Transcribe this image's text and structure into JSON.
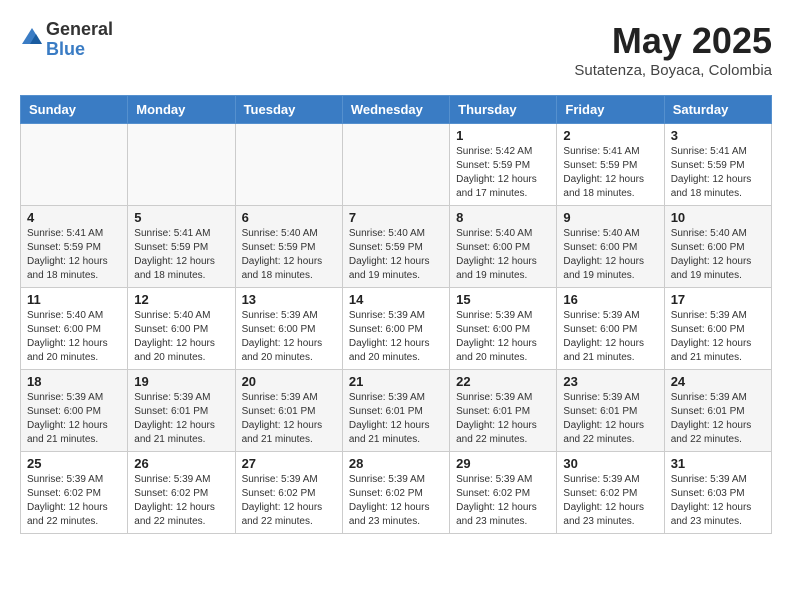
{
  "logo": {
    "general": "General",
    "blue": "Blue"
  },
  "title": {
    "month": "May 2025",
    "location": "Sutatenza, Boyaca, Colombia"
  },
  "weekdays": [
    "Sunday",
    "Monday",
    "Tuesday",
    "Wednesday",
    "Thursday",
    "Friday",
    "Saturday"
  ],
  "weeks": [
    [
      {
        "day": "",
        "info": ""
      },
      {
        "day": "",
        "info": ""
      },
      {
        "day": "",
        "info": ""
      },
      {
        "day": "",
        "info": ""
      },
      {
        "day": "1",
        "info": "Sunrise: 5:42 AM\nSunset: 5:59 PM\nDaylight: 12 hours\nand 17 minutes."
      },
      {
        "day": "2",
        "info": "Sunrise: 5:41 AM\nSunset: 5:59 PM\nDaylight: 12 hours\nand 18 minutes."
      },
      {
        "day": "3",
        "info": "Sunrise: 5:41 AM\nSunset: 5:59 PM\nDaylight: 12 hours\nand 18 minutes."
      }
    ],
    [
      {
        "day": "4",
        "info": "Sunrise: 5:41 AM\nSunset: 5:59 PM\nDaylight: 12 hours\nand 18 minutes."
      },
      {
        "day": "5",
        "info": "Sunrise: 5:41 AM\nSunset: 5:59 PM\nDaylight: 12 hours\nand 18 minutes."
      },
      {
        "day": "6",
        "info": "Sunrise: 5:40 AM\nSunset: 5:59 PM\nDaylight: 12 hours\nand 18 minutes."
      },
      {
        "day": "7",
        "info": "Sunrise: 5:40 AM\nSunset: 5:59 PM\nDaylight: 12 hours\nand 19 minutes."
      },
      {
        "day": "8",
        "info": "Sunrise: 5:40 AM\nSunset: 6:00 PM\nDaylight: 12 hours\nand 19 minutes."
      },
      {
        "day": "9",
        "info": "Sunrise: 5:40 AM\nSunset: 6:00 PM\nDaylight: 12 hours\nand 19 minutes."
      },
      {
        "day": "10",
        "info": "Sunrise: 5:40 AM\nSunset: 6:00 PM\nDaylight: 12 hours\nand 19 minutes."
      }
    ],
    [
      {
        "day": "11",
        "info": "Sunrise: 5:40 AM\nSunset: 6:00 PM\nDaylight: 12 hours\nand 20 minutes."
      },
      {
        "day": "12",
        "info": "Sunrise: 5:40 AM\nSunset: 6:00 PM\nDaylight: 12 hours\nand 20 minutes."
      },
      {
        "day": "13",
        "info": "Sunrise: 5:39 AM\nSunset: 6:00 PM\nDaylight: 12 hours\nand 20 minutes."
      },
      {
        "day": "14",
        "info": "Sunrise: 5:39 AM\nSunset: 6:00 PM\nDaylight: 12 hours\nand 20 minutes."
      },
      {
        "day": "15",
        "info": "Sunrise: 5:39 AM\nSunset: 6:00 PM\nDaylight: 12 hours\nand 20 minutes."
      },
      {
        "day": "16",
        "info": "Sunrise: 5:39 AM\nSunset: 6:00 PM\nDaylight: 12 hours\nand 21 minutes."
      },
      {
        "day": "17",
        "info": "Sunrise: 5:39 AM\nSunset: 6:00 PM\nDaylight: 12 hours\nand 21 minutes."
      }
    ],
    [
      {
        "day": "18",
        "info": "Sunrise: 5:39 AM\nSunset: 6:00 PM\nDaylight: 12 hours\nand 21 minutes."
      },
      {
        "day": "19",
        "info": "Sunrise: 5:39 AM\nSunset: 6:01 PM\nDaylight: 12 hours\nand 21 minutes."
      },
      {
        "day": "20",
        "info": "Sunrise: 5:39 AM\nSunset: 6:01 PM\nDaylight: 12 hours\nand 21 minutes."
      },
      {
        "day": "21",
        "info": "Sunrise: 5:39 AM\nSunset: 6:01 PM\nDaylight: 12 hours\nand 21 minutes."
      },
      {
        "day": "22",
        "info": "Sunrise: 5:39 AM\nSunset: 6:01 PM\nDaylight: 12 hours\nand 22 minutes."
      },
      {
        "day": "23",
        "info": "Sunrise: 5:39 AM\nSunset: 6:01 PM\nDaylight: 12 hours\nand 22 minutes."
      },
      {
        "day": "24",
        "info": "Sunrise: 5:39 AM\nSunset: 6:01 PM\nDaylight: 12 hours\nand 22 minutes."
      }
    ],
    [
      {
        "day": "25",
        "info": "Sunrise: 5:39 AM\nSunset: 6:02 PM\nDaylight: 12 hours\nand 22 minutes."
      },
      {
        "day": "26",
        "info": "Sunrise: 5:39 AM\nSunset: 6:02 PM\nDaylight: 12 hours\nand 22 minutes."
      },
      {
        "day": "27",
        "info": "Sunrise: 5:39 AM\nSunset: 6:02 PM\nDaylight: 12 hours\nand 22 minutes."
      },
      {
        "day": "28",
        "info": "Sunrise: 5:39 AM\nSunset: 6:02 PM\nDaylight: 12 hours\nand 23 minutes."
      },
      {
        "day": "29",
        "info": "Sunrise: 5:39 AM\nSunset: 6:02 PM\nDaylight: 12 hours\nand 23 minutes."
      },
      {
        "day": "30",
        "info": "Sunrise: 5:39 AM\nSunset: 6:02 PM\nDaylight: 12 hours\nand 23 minutes."
      },
      {
        "day": "31",
        "info": "Sunrise: 5:39 AM\nSunset: 6:03 PM\nDaylight: 12 hours\nand 23 minutes."
      }
    ]
  ]
}
